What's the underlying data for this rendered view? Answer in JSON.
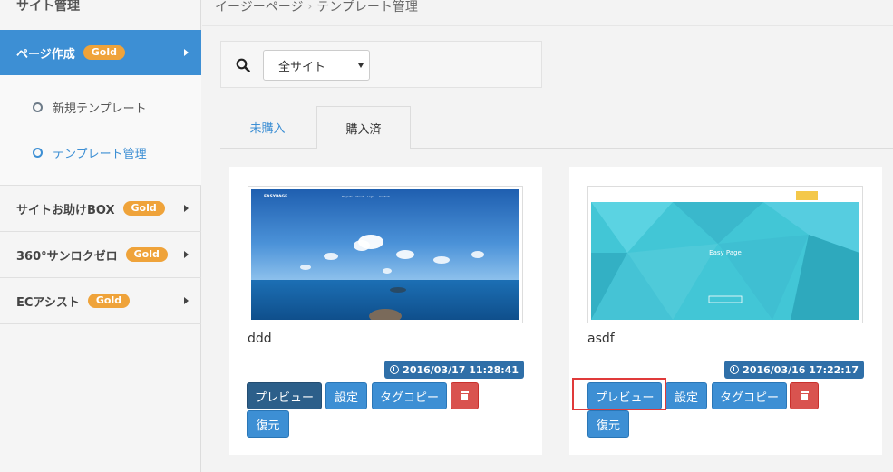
{
  "sidebar": {
    "top_label": "サイト管理",
    "active_item": {
      "label": "ページ作成",
      "badge": "Gold"
    },
    "sub_items": [
      {
        "label": "新規テンプレート",
        "active": false
      },
      {
        "label": "テンプレート管理",
        "active": true
      }
    ],
    "items": [
      {
        "label": "サイトお助けBOX",
        "badge": "Gold"
      },
      {
        "label": "360°サンロクゼロ",
        "badge": "Gold"
      },
      {
        "label": "ECアシスト",
        "badge": "Gold"
      }
    ]
  },
  "breadcrumb": {
    "root": "イージーページ",
    "separator": "›",
    "current": "テンプレート管理"
  },
  "search": {
    "select_value": "全サイト"
  },
  "tabs": [
    {
      "label": "未購入",
      "active": false
    },
    {
      "label": "購入済",
      "active": true
    }
  ],
  "cards": [
    {
      "title": "ddd",
      "date": "2016/03/17 11:28:41",
      "thumb": {
        "brand": "EASYPAGE",
        "nav": [
          "Projects",
          "About",
          "Login",
          "Contact"
        ]
      },
      "buttons": {
        "preview": "プレビュー",
        "settings": "設定",
        "tag_copy": "タグコピー",
        "restore": "復元"
      }
    },
    {
      "title": "asdf",
      "date": "2016/03/16 17:22:17",
      "thumb": {
        "heading": "Easy Page"
      },
      "buttons": {
        "preview": "プレビュー",
        "settings": "設定",
        "tag_copy": "タグコピー",
        "restore": "復元"
      }
    }
  ],
  "colors": {
    "accent": "#3d8fd4",
    "gold_badge": "#efa33a",
    "date_badge": "#2f6fa8",
    "danger": "#d9534f",
    "highlight": "#e03a3a"
  }
}
